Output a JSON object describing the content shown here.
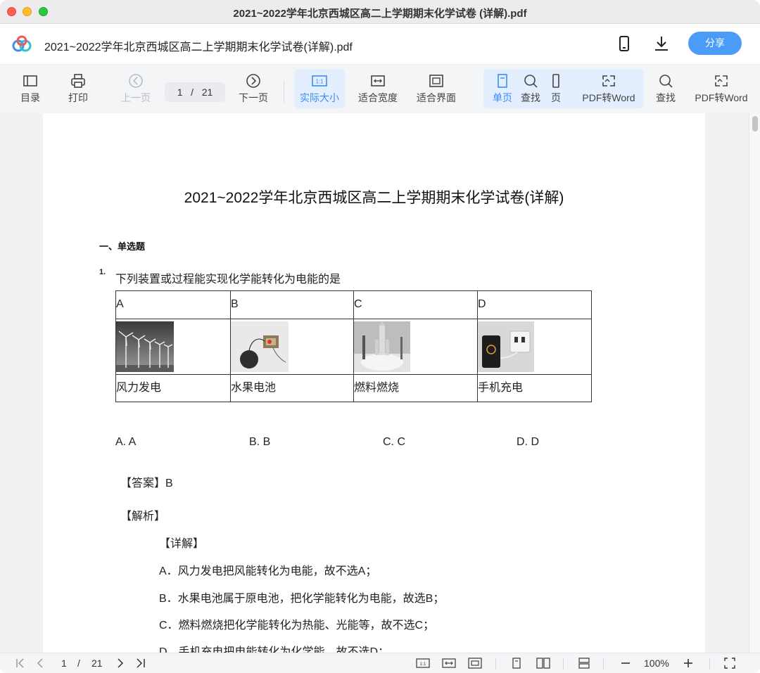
{
  "window": {
    "title": "2021~2022学年北京西城区高二上学期期末化学试卷 (详解).pdf"
  },
  "header": {
    "doc_name": "2021~2022学年北京西城区高二上学期期末化学试卷(详解).pdf",
    "share_label": "分享",
    "icons": [
      "cloud-logo-icon",
      "phone-icon",
      "download-icon"
    ]
  },
  "toolbar": {
    "toc": "目录",
    "print": "打印",
    "prev": "上一页",
    "page_current": "1",
    "page_sep": "/",
    "page_total": "21",
    "next": "下一页",
    "actual_size": "实际大小",
    "fit_width": "适合宽度",
    "fit_page": "适合界面",
    "single_page": "单页",
    "find_1": "查找",
    "page_short": "页",
    "pdf_to_word_1": "PDF转Word",
    "find_2": "查找",
    "pdf_to_word_2": "PDF转Word",
    "actual_size_glyph": "1:1"
  },
  "document": {
    "title": "2021~2022学年北京西城区高二上学期期末化学试卷(详解)",
    "section": "一、单选题",
    "question_number": "1.",
    "question_text": "下列装置或过程能实现化学能转化为电能的是",
    "table": {
      "headers": [
        "A",
        "B",
        "C",
        "D"
      ],
      "images": [
        "wind-turbines",
        "fruit-battery",
        "rocket-launch",
        "phone-charging"
      ],
      "names": [
        "风力发电",
        "水果电池",
        "燃料燃烧",
        "手机充电"
      ]
    },
    "options": [
      "A. A",
      "B. B",
      "C. C",
      "D. D"
    ],
    "answer": "【答案】B",
    "analysis": "【解析】",
    "detail_heading": "【详解】",
    "detail_lines": [
      "A．风力发电把风能转化为电能，故不选A；",
      "B．水果电池属于原电池，把化学能转化为电能，故选B；",
      "C．燃料燃烧把化学能转化为热能、光能等，故不选C；",
      "D．手机充电把电能转化为化学能，故不选D；"
    ]
  },
  "statusbar": {
    "page_current": "1",
    "page_sep": "/",
    "page_total": "21",
    "zoom": "100%",
    "actual_size_glyph": "1:1"
  },
  "colors": {
    "accent": "#4b9bf8",
    "active_bg": "#e3efff"
  }
}
